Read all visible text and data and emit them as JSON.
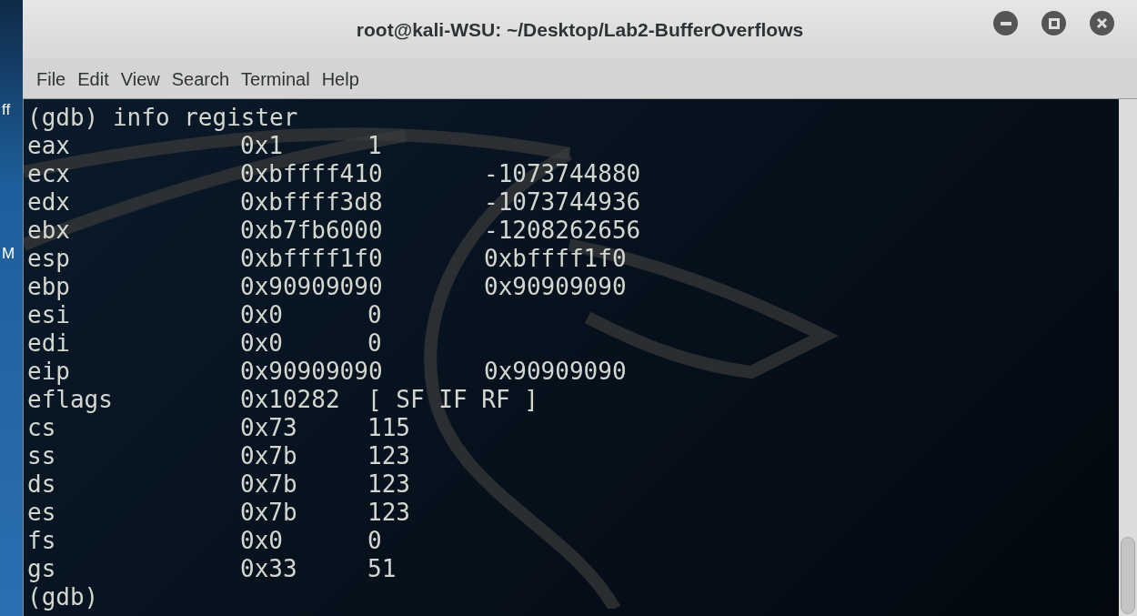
{
  "desktop": {
    "labels": [
      "ff",
      "M"
    ]
  },
  "window": {
    "title": "root@kali-WSU: ~/Desktop/Lab2-BufferOverflows"
  },
  "menu": [
    "File",
    "Edit",
    "View",
    "Search",
    "Terminal",
    "Help"
  ],
  "terminal": {
    "lines": [
      {
        "kind": "prompt",
        "text": "(gdb) info register"
      },
      {
        "kind": "register",
        "name": "eax",
        "raw": "0x1",
        "natural": "1"
      },
      {
        "kind": "register",
        "name": "ecx",
        "raw": "0xbffff410",
        "natural": "-1073744880"
      },
      {
        "kind": "register",
        "name": "edx",
        "raw": "0xbffff3d8",
        "natural": "-1073744936"
      },
      {
        "kind": "register",
        "name": "ebx",
        "raw": "0xb7fb6000",
        "natural": "-1208262656"
      },
      {
        "kind": "register",
        "name": "esp",
        "raw": "0xbffff1f0",
        "natural": "0xbffff1f0"
      },
      {
        "kind": "register",
        "name": "ebp",
        "raw": "0x90909090",
        "natural": "0x90909090"
      },
      {
        "kind": "register",
        "name": "esi",
        "raw": "0x0",
        "natural": "0"
      },
      {
        "kind": "register",
        "name": "edi",
        "raw": "0x0",
        "natural": "0"
      },
      {
        "kind": "register",
        "name": "eip",
        "raw": "0x90909090",
        "natural": "0x90909090"
      },
      {
        "kind": "register",
        "name": "eflags",
        "raw": "0x10282",
        "natural": "[ SF IF RF ]"
      },
      {
        "kind": "register",
        "name": "cs",
        "raw": "0x73",
        "natural": "115"
      },
      {
        "kind": "register",
        "name": "ss",
        "raw": "0x7b",
        "natural": "123"
      },
      {
        "kind": "register",
        "name": "ds",
        "raw": "0x7b",
        "natural": "123"
      },
      {
        "kind": "register",
        "name": "es",
        "raw": "0x7b",
        "natural": "123"
      },
      {
        "kind": "register",
        "name": "fs",
        "raw": "0x0",
        "natural": "0"
      },
      {
        "kind": "register",
        "name": "gs",
        "raw": "0x33",
        "natural": "51"
      },
      {
        "kind": "prompt",
        "text": "(gdb)"
      }
    ]
  }
}
